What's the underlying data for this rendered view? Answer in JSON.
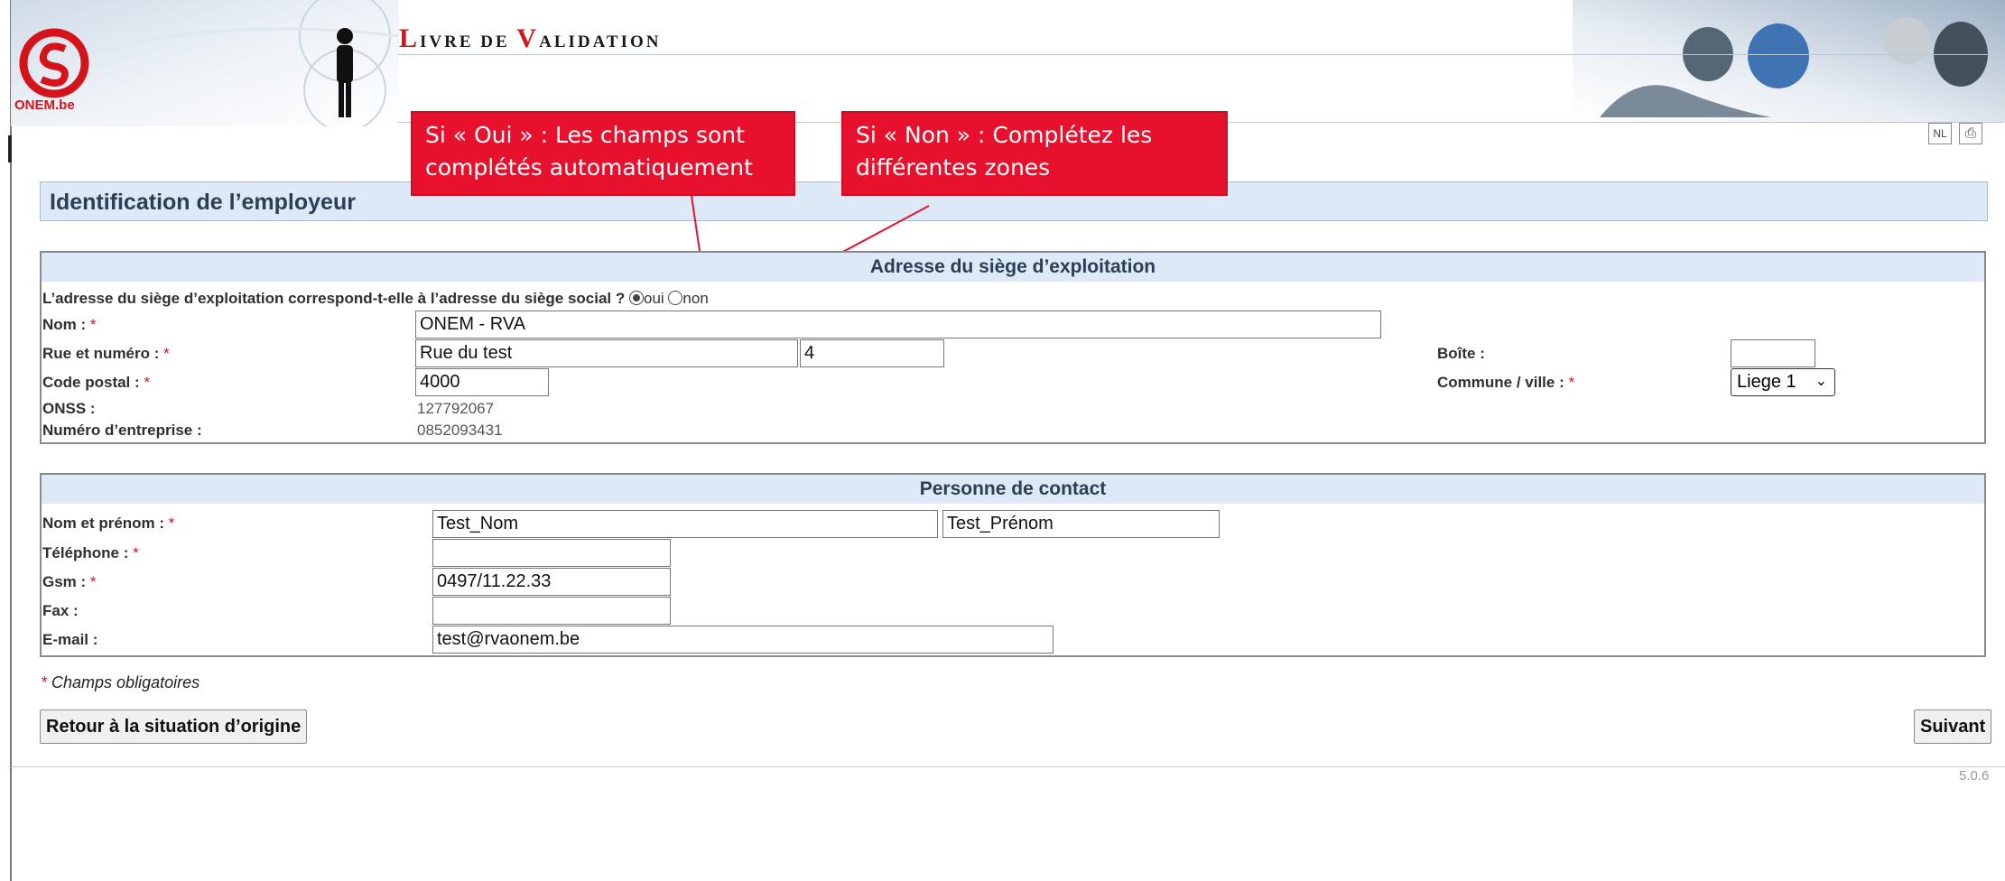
{
  "header": {
    "app_title_cap1": "L",
    "app_title_rest1": "IVRE DE ",
    "app_title_cap2": "V",
    "app_title_rest2": "ALIDATION",
    "logo_text": "ONEM.be",
    "lang_button": "NL",
    "print_icon": "printer-icon"
  },
  "callouts": {
    "oui": "Si « Oui » : Les champs sont complétés automatiquement",
    "non": "Si « Non » : Complétez les différentes zones"
  },
  "page_title": "Identification de l’employeur",
  "siege": {
    "title": "Adresse du siège d’exploitation",
    "question": "L’adresse du siège d’exploitation correspond-t-elle à l’adresse du siège social ?",
    "radio_oui": "oui",
    "radio_non": "non",
    "selected": "oui",
    "nom_label": "Nom :",
    "nom_value": "ONEM - RVA",
    "rue_label": "Rue et numéro :",
    "rue_value": "Rue du test",
    "numero_value": "4",
    "boite_label": "Boîte :",
    "boite_value": "",
    "cp_label": "Code postal :",
    "cp_value": "4000",
    "commune_label": "Commune / ville :",
    "commune_value": "Liege 1",
    "onss_label": "ONSS :",
    "onss_value": "127792067",
    "entreprise_label": "Numéro d’entreprise :",
    "entreprise_value": "0852093431",
    "required_mark": "*"
  },
  "contact": {
    "title": "Personne de contact",
    "nom_label": "Nom et prénom :",
    "nom_value": "Test_Nom",
    "prenom_value": "Test_Prénom",
    "tel_label": "Téléphone :",
    "tel_value": "",
    "gsm_label": "Gsm :",
    "gsm_value": "0497/11.22.33",
    "fax_label": "Fax :",
    "fax_value": "",
    "email_label": "E-mail :",
    "email_value": "test@rvaonem.be"
  },
  "footer": {
    "required_note_star": "*",
    "required_note": " Champs obligatoires",
    "back_button": "Retour à la situation d’origine",
    "next_button": "Suivant",
    "version": "5.0.6"
  }
}
